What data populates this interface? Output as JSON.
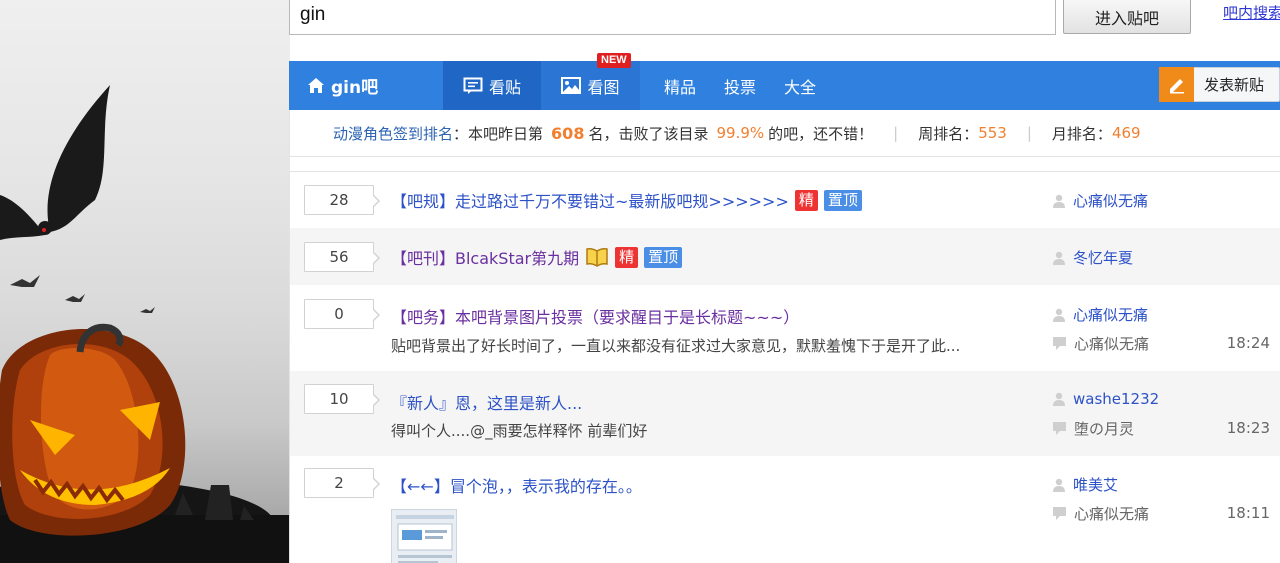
{
  "search": {
    "value": "gin",
    "enter_label": "进入贴吧",
    "inner_search_label": "吧内搜索"
  },
  "nav": {
    "home_label": "gin吧",
    "tabs": [
      "看贴",
      "看图"
    ],
    "new_badge": "NEW",
    "links": [
      "精品",
      "投票",
      "大全"
    ],
    "post_label": "发表新贴"
  },
  "rank": {
    "link": "动漫角色签到排名",
    "colon": "：",
    "prefix": "本吧昨日第",
    "rank_num": "608",
    "mid": "名，击败了该目录",
    "percent": "99.9%",
    "suffix": "的吧，还不错！",
    "week_label": "周排名：",
    "week_value": "553",
    "month_label": "月排名：",
    "month_value": "469",
    "divider": "|"
  },
  "threads": [
    {
      "count": "28",
      "title": "【吧规】走过路过千万不要错过~最新版吧规>>>>>>",
      "badges": [
        "精",
        "置顶"
      ],
      "author": "心痛似无痛"
    },
    {
      "count": "56",
      "title": "【吧刊】BlcakStar第九期",
      "badges": [
        "精",
        "置顶"
      ],
      "author": "冬忆年夏"
    },
    {
      "count": "0",
      "title": "【吧务】本吧背景图片投票（要求醒目于是长标题~~~）",
      "abstract": "贴吧背景出了好长时间了，一直以来都没有征求过大家意见，默默羞愧下于是开了此...",
      "author": "心痛似无痛",
      "replier": "心痛似无痛",
      "time": "18:24"
    },
    {
      "count": "10",
      "title": "『新人』恩，这里是新人...",
      "abstract": "得叫个人....@_雨要怎样释怀  前辈们好",
      "author": "washe1232",
      "replier": "堕の月灵",
      "time": "18:23"
    },
    {
      "count": "2",
      "title": "【←←】冒个泡，，表示我的存在。。",
      "author": "唯美艾",
      "replier": "心痛似无痛",
      "time": "18:11"
    }
  ],
  "colors": {
    "nav_blue": "#2f80df",
    "accent_orange": "#f08030",
    "link_blue": "#2d52c8"
  }
}
